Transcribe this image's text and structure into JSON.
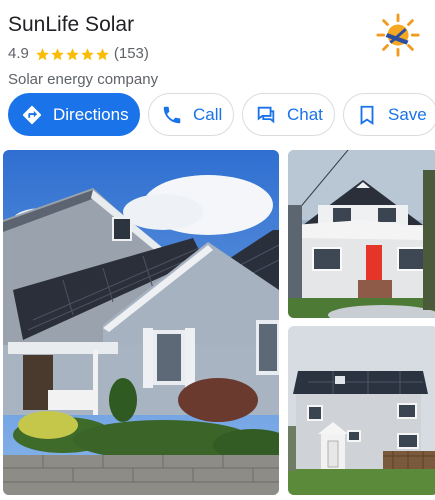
{
  "business": {
    "name": "SunLife Solar",
    "rating": "4.9",
    "stars": 5,
    "review_count": "(153)",
    "category": "Solar energy company"
  },
  "actions": {
    "directions": "Directions",
    "call": "Call",
    "chat": "Chat",
    "save": "Save"
  },
  "colors": {
    "primary": "#1a73e8",
    "star": "#fbbc04",
    "text_secondary": "#5f6368"
  },
  "icons": {
    "directions": "directions-diamond-icon",
    "call": "phone-icon",
    "chat": "chat-bubble-icon",
    "save": "bookmark-icon",
    "logo": "sun-logo-icon"
  },
  "photos": [
    {
      "name": "house-photo-main"
    },
    {
      "name": "house-photo-red-door"
    },
    {
      "name": "house-photo-back"
    }
  ]
}
